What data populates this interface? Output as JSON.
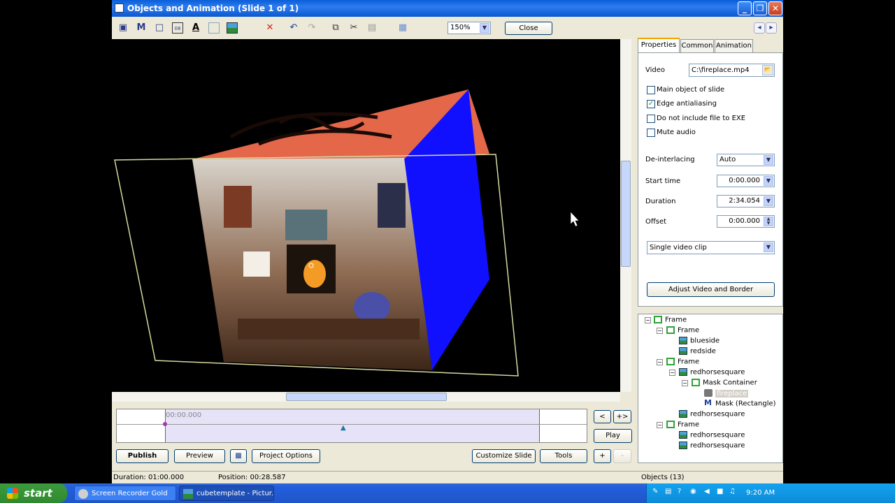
{
  "window": {
    "title": "Objects and Animation  (Slide 1 of 1)",
    "buttons": [
      "_",
      "❐",
      "✕"
    ]
  },
  "toolbar": {
    "icons": [
      "video-camera-icon",
      "mask-icon",
      "rectangle-icon",
      "counter-icon",
      "text-icon",
      "blank-image-icon",
      "image-icon",
      "delete-icon",
      "undo-icon",
      "redo-icon",
      "copy-icon",
      "cut-icon",
      "paste-icon",
      "grid-icon"
    ],
    "zoom": "150%",
    "close_label": "Close",
    "nav_prev": "◂",
    "nav_next": "▸"
  },
  "timeline": {
    "time_label": "00:00.000",
    "prev_label": "<",
    "add_key_label": "+>",
    "play_label": "Play",
    "plus_label": "+",
    "minus_label": "-"
  },
  "bottom_buttons": {
    "publish": "Publish",
    "preview": "Preview",
    "project_options": "Project Options",
    "customize_slide": "Customize Slide",
    "tools": "Tools"
  },
  "status": {
    "duration": "Duration:  01:00.000",
    "position": "Position:  00:28.587",
    "objects": "Objects (13)"
  },
  "tabs": [
    "Properties",
    "Common",
    "Animation"
  ],
  "properties": {
    "video_label": "Video",
    "video_value": "C:\\fireplace.mp4",
    "checkboxes": [
      {
        "label": "Main object of slide",
        "checked": false
      },
      {
        "label": "Edge antialiasing",
        "checked": true
      },
      {
        "label": "Do not include file to EXE",
        "checked": false
      },
      {
        "label": "Mute audio",
        "checked": false
      }
    ],
    "deinterlacing_label": "De-interlacing",
    "deinterlacing_value": "Auto",
    "start_label": "Start time",
    "start_value": "0:00.000",
    "duration_label": "Duration",
    "duration_value": "2:34.054",
    "offset_label": "Offset",
    "offset_value": "0:00.000",
    "clip_mode": "Single video clip",
    "adjust_button": "Adjust Video and Border"
  },
  "tree": [
    {
      "label": "Frame",
      "type": "frame"
    },
    {
      "label": "Frame",
      "type": "frame"
    },
    {
      "label": "blueside",
      "type": "img"
    },
    {
      "label": "redside",
      "type": "img"
    },
    {
      "label": "Frame",
      "type": "frame"
    },
    {
      "label": "redhorsesquare",
      "type": "img"
    },
    {
      "label": "Mask Container",
      "type": "frame"
    },
    {
      "label": "fireplace",
      "type": "vid"
    },
    {
      "label": "Mask (Rectangle)",
      "type": "mask"
    },
    {
      "label": "redhorsesquare",
      "type": "img"
    },
    {
      "label": "Frame",
      "type": "frame"
    },
    {
      "label": "redhorsesquare",
      "type": "img"
    },
    {
      "label": "redhorsesquare",
      "type": "img"
    }
  ],
  "taskbar": {
    "start": "start",
    "tasks": [
      "Screen Recorder Gold",
      "cubetemplate - Pictur..."
    ],
    "clock": "9:20 AM"
  },
  "colors": {
    "cube_top": "#e5674a",
    "cube_side": "#1010ff",
    "selection": "#d8d9a0"
  }
}
